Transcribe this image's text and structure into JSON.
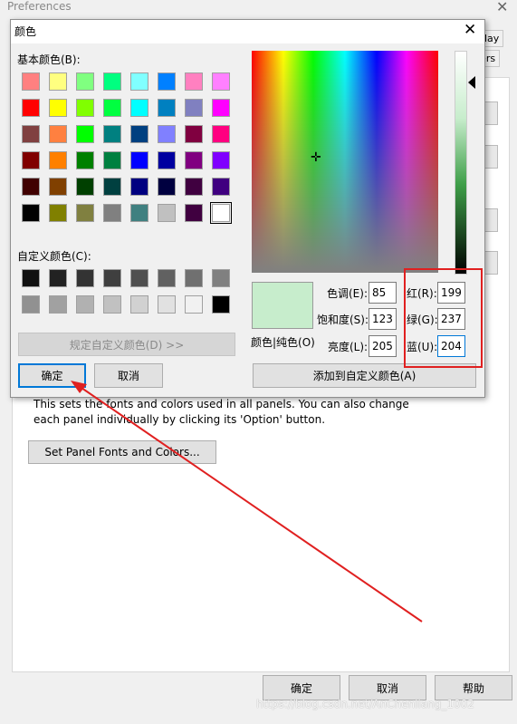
{
  "background_window": {
    "title": "Preferences",
    "close_glyph": "✕",
    "tab_labels": [
      "lay",
      "lers"
    ],
    "description": "This sets the fonts and colors used in all panels. You can also change each panel individually by clicking its 'Option' button.",
    "set_fonts_button": "Set Panel Fonts and Colors...",
    "ok_button": "确定",
    "cancel_button": "取消",
    "help_button": "帮助"
  },
  "dialog": {
    "title": "颜色",
    "close_glyph": "✕",
    "basic_colors_label": "基本颜色(B):",
    "basic_colors": [
      "#ff8080",
      "#ffff80",
      "#80ff80",
      "#00ff80",
      "#80ffff",
      "#0080ff",
      "#ff80c0",
      "#ff80ff",
      "#ff0000",
      "#ffff00",
      "#80ff00",
      "#00ff40",
      "#00ffff",
      "#0080c0",
      "#8080c0",
      "#ff00ff",
      "#804040",
      "#ff8040",
      "#00ff00",
      "#008080",
      "#004080",
      "#8080ff",
      "#800040",
      "#ff0080",
      "#800000",
      "#ff8000",
      "#008000",
      "#008040",
      "#0000ff",
      "#0000a0",
      "#800080",
      "#8000ff",
      "#400000",
      "#804000",
      "#004000",
      "#004040",
      "#000080",
      "#000040",
      "#400040",
      "#400080",
      "#000000",
      "#808000",
      "#808040",
      "#808080",
      "#408080",
      "#c0c0c0",
      "#400040",
      "#ffffff"
    ],
    "custom_colors_label": "自定义颜色(C):",
    "custom_colors": [
      "#111111",
      "#222222",
      "#333333",
      "#3f3f3f",
      "#4f4f4f",
      "#616161",
      "#707070",
      "#808080",
      "#919191",
      "#a1a1a1",
      "#b1b1b1",
      "#c1c1c1",
      "#d1d1d1",
      "#e1e1e1",
      "#f1f1f1",
      "#000000"
    ],
    "define_custom_button": "规定自定义颜色(D) >>",
    "ok_button": "确定",
    "cancel_button": "取消",
    "color_solid_label": "颜色|纯色(O)",
    "current_color": "#c7edcc",
    "hue_label": "色调(E):",
    "hue": "85",
    "sat_label": "饱和度(S):",
    "sat": "123",
    "lum_label": "亮度(L):",
    "lum": "205",
    "red_label": "红(R):",
    "red": "199",
    "green_label": "绿(G):",
    "green": "237",
    "blue_label": "蓝(U):",
    "blue": "204",
    "add_custom_button": "添加到自定义颜色(A)"
  },
  "watermark": "https://blog.csdn.net/AnChenliang_1002",
  "annotation_color": "#e02020"
}
